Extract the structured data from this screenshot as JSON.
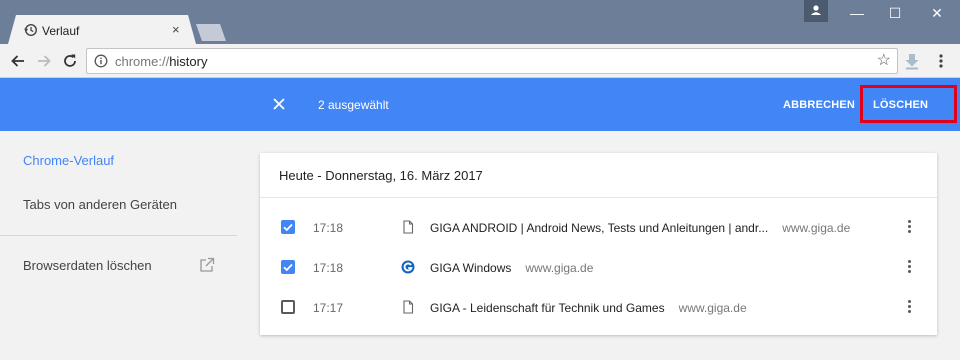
{
  "browser": {
    "tab_title": "Verlauf",
    "tab_close": "×",
    "window_controls": {
      "minimize": "—",
      "maximize": "☐",
      "close": "✕"
    },
    "url": {
      "scheme": "chrome://",
      "host": "history"
    },
    "bookmark_star": "☆"
  },
  "selection": {
    "count_text": "2 ausgewählt",
    "cancel_label": "ABBRECHEN",
    "delete_label": "LÖSCHEN"
  },
  "sidebar": {
    "items": [
      {
        "label": "Chrome-Verlauf"
      },
      {
        "label": "Tabs von anderen Geräten"
      },
      {
        "label": "Browserdaten löschen"
      }
    ]
  },
  "history": {
    "date_header": "Heute - Donnerstag, 16. März 2017",
    "entries": [
      {
        "time": "17:18",
        "title": "GIGA ANDROID | Android News, Tests und Anleitungen | andr...",
        "domain": "www.giga.de",
        "checked": true,
        "favicon": "page-icon"
      },
      {
        "time": "17:18",
        "title": "GIGA Windows",
        "domain": "www.giga.de",
        "checked": true,
        "favicon": "giga-g-icon"
      },
      {
        "time": "17:17",
        "title": "GIGA - Leidenschaft für Technik und Games",
        "domain": "www.giga.de",
        "checked": false,
        "favicon": "page-icon"
      }
    ]
  },
  "colors": {
    "accent": "#4285f4",
    "highlight": "#e3001b",
    "titlebar": "#6d7e99"
  }
}
